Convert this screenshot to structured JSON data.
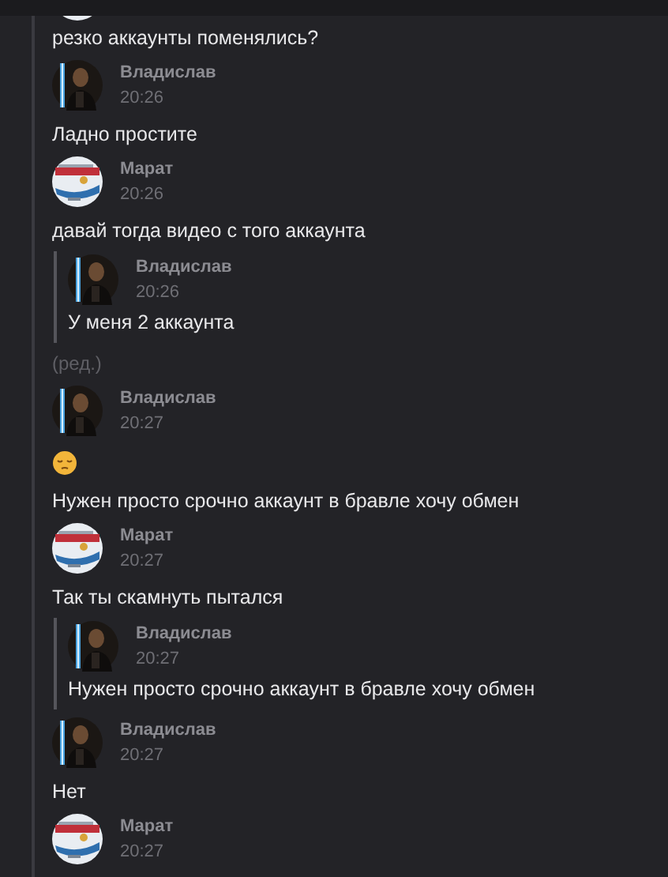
{
  "messages": [
    {
      "kind": "tail",
      "avatar": {
        "kind": "light"
      },
      "parts": [
        {
          "kind": "text",
          "text": "резко аккаунты поменялись?"
        }
      ]
    },
    {
      "kind": "message",
      "author": "Владислав",
      "time": "20:26",
      "avatar": {
        "kind": "dark"
      },
      "parts": [
        {
          "kind": "text",
          "text": "Ладно простите"
        }
      ]
    },
    {
      "kind": "message",
      "author": "Марат",
      "time": "20:26",
      "avatar": {
        "kind": "light"
      },
      "parts": [
        {
          "kind": "text",
          "text": "давай тогда видео с того аккаунта"
        },
        {
          "kind": "quote",
          "author": "Владислав",
          "time": "20:26",
          "avatar": {
            "kind": "dark"
          },
          "text": "У меня 2 аккаунта"
        },
        {
          "kind": "note",
          "text": "(ред.)"
        }
      ]
    },
    {
      "kind": "message",
      "author": "Владислав",
      "time": "20:27",
      "avatar": {
        "kind": "dark"
      },
      "parts": [
        {
          "kind": "emoji"
        },
        {
          "kind": "text",
          "text": "Нужен просто срочно аккаунт в бравле хочу обмен"
        }
      ]
    },
    {
      "kind": "message",
      "author": "Марат",
      "time": "20:27",
      "avatar": {
        "kind": "light"
      },
      "parts": [
        {
          "kind": "text",
          "text": "Так ты скамнуть пытался"
        },
        {
          "kind": "quote",
          "author": "Владислав",
          "time": "20:27",
          "avatar": {
            "kind": "dark"
          },
          "text": "Нужен просто срочно аккаунт в бравле хочу обмен"
        }
      ]
    },
    {
      "kind": "message",
      "author": "Владислав",
      "time": "20:27",
      "avatar": {
        "kind": "dark"
      },
      "parts": [
        {
          "kind": "text",
          "text": "Нет"
        }
      ]
    },
    {
      "kind": "message",
      "author": "Марат",
      "time": "20:27",
      "avatar": {
        "kind": "light"
      }
    }
  ]
}
